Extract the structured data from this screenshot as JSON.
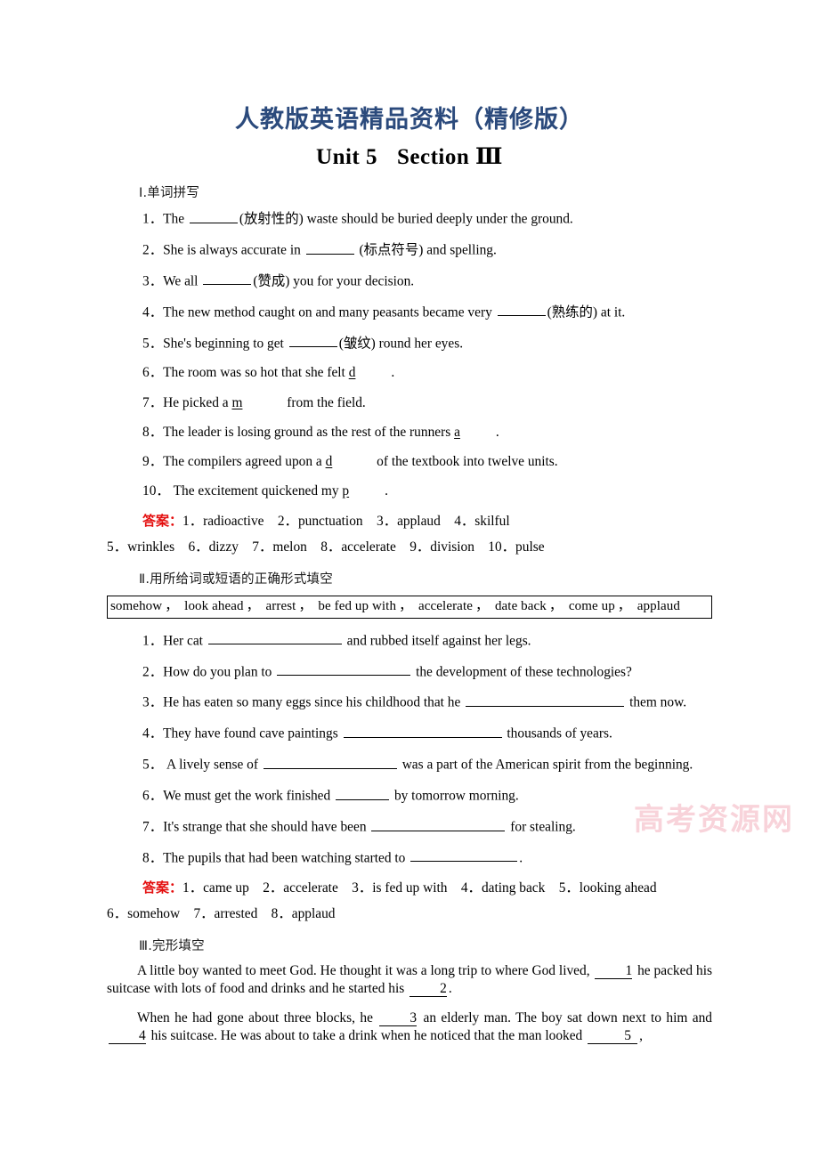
{
  "header": {
    "publisher_line": "人教版英语精品资料（精修版）",
    "title_unit": "Unit 5",
    "title_section": "Section",
    "title_numeral": "Ⅲ"
  },
  "watermark": {
    "text": "高考资源网"
  },
  "sections": [
    {
      "heading": "Ⅰ.单词拼写",
      "questions": [
        {
          "num": "1．",
          "pre": "The",
          "hint": "(放射性的)",
          "post": "waste should be buried deeply under the ground."
        },
        {
          "num": "2．",
          "pre": "She is always accurate in",
          "hint": "(标点符号)",
          "post": "and spelling."
        },
        {
          "num": "3．",
          "pre": "We all",
          "hint": "(赞成)",
          "post": "you for your decision."
        },
        {
          "num": "4．",
          "pre": "The new method caught on and many peasants became very",
          "hint": "(熟练的)",
          "post": "at it."
        },
        {
          "num": "5．",
          "pre": "She's beginning to get",
          "hint": "(皱纹)",
          "post": "round her eyes."
        },
        {
          "num": "6．",
          "pre": "The room was so hot that she felt",
          "letter": "d",
          "post": "."
        },
        {
          "num": "7．",
          "pre": "He picked a",
          "letter": "m",
          "post": "from the field."
        },
        {
          "num": "8．",
          "pre": "The leader is losing ground as the rest of the runners",
          "letter": "a",
          "post": "."
        },
        {
          "num": "9．",
          "pre": "The compilers agreed upon a",
          "letter": "d",
          "post": "of the textbook into twelve units."
        },
        {
          "num": "10．",
          "pre": "The excitement quickened my",
          "letter": "p",
          "post": "."
        }
      ],
      "answer_label": "答案：",
      "answers_line1": "1．radioactive　2．punctuation　3．applaud　4．skilful",
      "answers_line2": "5．wrinkles　6．dizzy　7．melon　8．accelerate　9．division　10．pulse"
    },
    {
      "heading": "Ⅱ.用所给词或短语的正确形式填空",
      "wordbank": [
        "somehow",
        "look ahead",
        "arrest",
        "be fed up with",
        "accelerate",
        "date back",
        "come up",
        "applaud"
      ],
      "wordbank_separator": "，",
      "questions": [
        {
          "num": "1．",
          "pre": "Her cat",
          "post": "and rubbed itself against her legs."
        },
        {
          "num": "2．",
          "pre": "How do you plan to",
          "post": "the development of these technologies?"
        },
        {
          "num": "3．",
          "pre": "He has eaten so many eggs since his childhood that he",
          "post": "them now."
        },
        {
          "num": "4．",
          "pre": "They have found cave paintings",
          "post": "thousands of years."
        },
        {
          "num": "5．",
          "pre": "A lively sense of",
          "post": "was a part of the American spirit from the beginning."
        },
        {
          "num": "6．",
          "pre": "We must get the work finished",
          "post": "by tomorrow morning."
        },
        {
          "num": "7．",
          "pre": "It's strange that she should have been",
          "post": "for stealing."
        },
        {
          "num": "8．",
          "pre": "The pupils that had been watching started to",
          "post": "."
        }
      ],
      "answer_label": "答案：",
      "answers_line1": "1．came up　2．accelerate　3．is fed up with　4．dating back　5．looking ahead",
      "answers_line2": "6．somehow　7．arrested　8．applaud"
    },
    {
      "heading": "Ⅲ.完形填空",
      "paragraphs": [
        {
          "parts": [
            "A little boy wanted to meet God. He thought it was a long trip to where God lived,",
            "1",
            "he packed his suitcase with lots of food and drinks and he started his",
            "2",
            "."
          ]
        },
        {
          "parts": [
            "When he had gone about three blocks, he",
            "3",
            "an elderly man. The boy sat down next to him and",
            "4",
            "his suitcase. He was about to take a drink when he noticed that the man looked",
            "5",
            ","
          ]
        }
      ]
    }
  ]
}
